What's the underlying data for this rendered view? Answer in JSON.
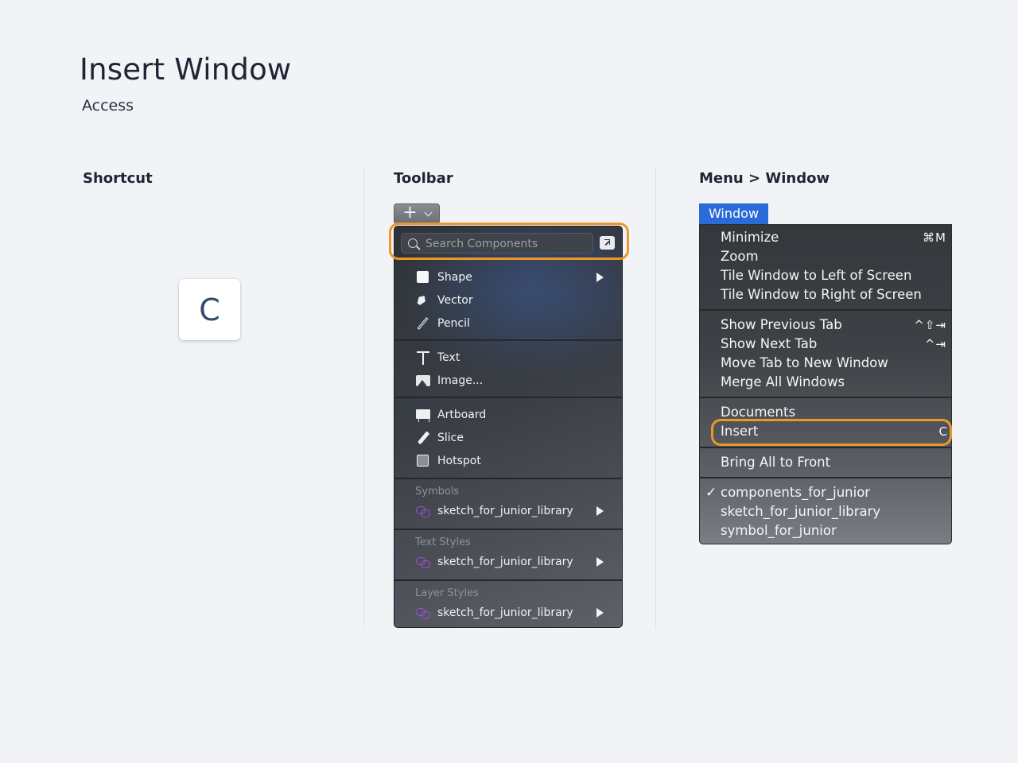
{
  "header": {
    "title": "Insert Window",
    "subtitle": "Access"
  },
  "columns": {
    "shortcut": "Shortcut",
    "toolbar": "Toolbar",
    "menu": "Menu > Window"
  },
  "shortcut": {
    "key": "C"
  },
  "toolbar": {
    "add_button": "+",
    "search_placeholder": "Search Components",
    "items": {
      "shape": "Shape",
      "vector": "Vector",
      "pencil": "Pencil",
      "text": "Text",
      "image": "Image...",
      "artboard": "Artboard",
      "slice": "Slice",
      "hotspot": "Hotspot"
    },
    "groups": {
      "symbols": {
        "label": "Symbols",
        "library": "sketch_for_junior_library"
      },
      "text_styles": {
        "label": "Text Styles",
        "library": "sketch_for_junior_library"
      },
      "layer_styles": {
        "label": "Layer Styles",
        "library": "sketch_for_junior_library"
      }
    }
  },
  "menu": {
    "title": "Window",
    "items": {
      "minimize": {
        "label": "Minimize",
        "shortcut": "⌘M"
      },
      "zoom": {
        "label": "Zoom"
      },
      "tile_left": {
        "label": "Tile Window to Left of Screen"
      },
      "tile_right": {
        "label": "Tile Window to Right of Screen"
      },
      "prev_tab": {
        "label": "Show Previous Tab",
        "shortcut": "^⇧⇥"
      },
      "next_tab": {
        "label": "Show Next Tab",
        "shortcut": "^⇥"
      },
      "move_tab": {
        "label": "Move Tab to New Window"
      },
      "merge": {
        "label": "Merge All Windows"
      },
      "documents": {
        "label": "Documents"
      },
      "insert": {
        "label": "Insert",
        "shortcut": "C"
      },
      "bring_front": {
        "label": "Bring All to Front"
      },
      "win1": {
        "label": "components_for_junior",
        "checked": true
      },
      "win2": {
        "label": "sketch_for_junior_library"
      },
      "win3": {
        "label": "symbol_for_junior"
      }
    }
  },
  "colors": {
    "highlight": "#ed9728",
    "menu_title_bg": "#2b6ad9",
    "library_icon": "#a34fd8"
  }
}
